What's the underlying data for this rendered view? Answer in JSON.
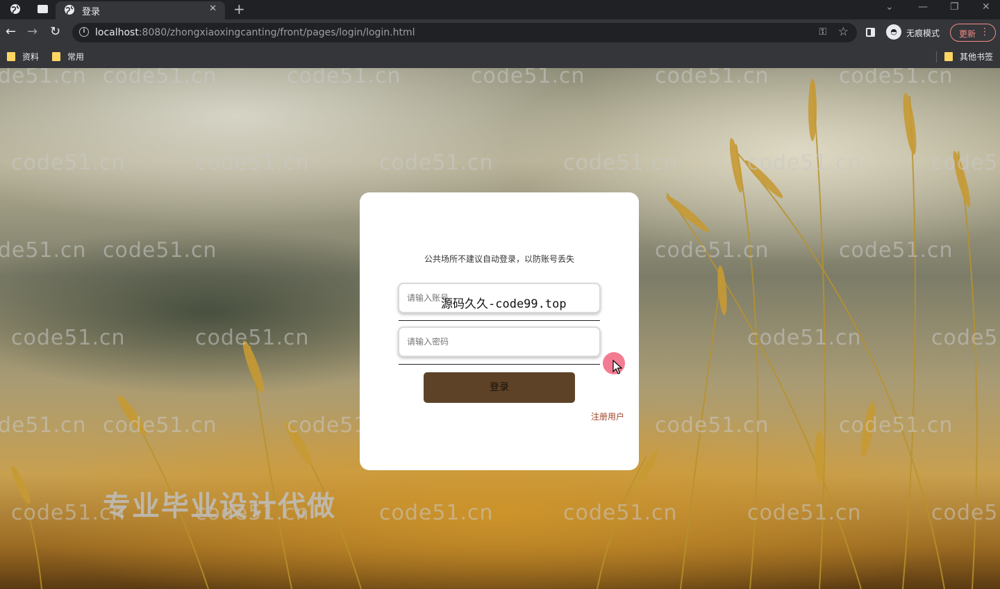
{
  "browser": {
    "tab_title": "登录",
    "url_host": "localhost",
    "url_path": ":8080/zhongxiaoxingcanting/front/pages/login/login.html",
    "incognito_label": "无痕模式",
    "update_label": "更新"
  },
  "bookmarks": {
    "items": [
      {
        "label": "资料"
      },
      {
        "label": "常用"
      }
    ],
    "other_label": "其他书签"
  },
  "page": {
    "watermark": "code51.cn",
    "slogan": "专业毕业设计代做"
  },
  "login": {
    "notice": "公共场所不建议自动登录，以防账号丢失",
    "account_placeholder": "请输入账号",
    "password_placeholder": "请输入密码",
    "overlay_text": "源码久久-code99.top",
    "login_label": "登录",
    "register_label": "注册用户"
  },
  "colors": {
    "login_button": "#5d4228",
    "register_link": "#a0442a",
    "card": "#ffffff"
  }
}
